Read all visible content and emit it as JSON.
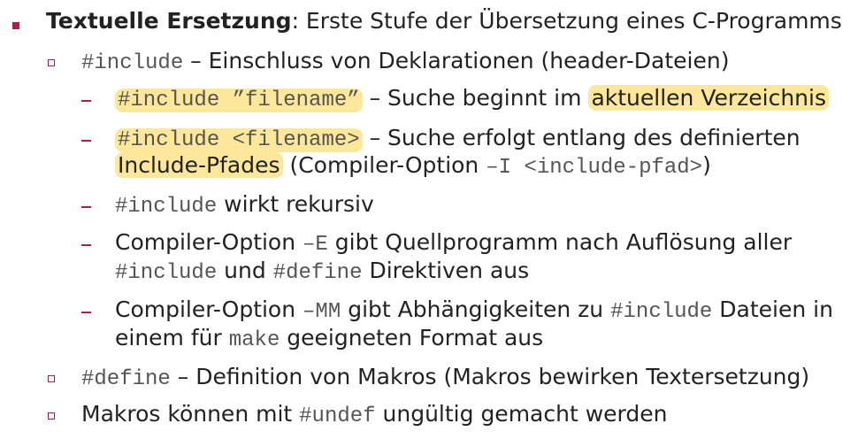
{
  "l1": {
    "head": "Textuelle Ersetzung",
    "rest": ": Erste Stufe der Übersetzung eines C-Programms"
  },
  "l2": {
    "code": "#include",
    "rest": " – Einschluss von Deklarationen (header-Dateien)"
  },
  "l3": {
    "code": "#include ”filename”",
    "mid": " – Suche beginnt im ",
    "hl": "aktuellen Verzeichnis"
  },
  "l4a": {
    "code": "#include <filename>",
    "rest": " – Suche erfolgt entlang des definierten"
  },
  "l4b": {
    "hl": "Include-Pfades",
    "mid": " (Compiler-Option ",
    "code": "–I <include-pfad>",
    "end": ")"
  },
  "l5": {
    "code": "#include",
    "rest": " wirkt rekursiv"
  },
  "l6a": {
    "pre": "Compiler-Option ",
    "code": "–E",
    "rest": " gibt Quellprogramm nach Auflösung aller"
  },
  "l6b": {
    "code1": "#include",
    "mid": " und ",
    "code2": "#define",
    "rest": " Direktiven aus"
  },
  "l7a": {
    "pre": "Compiler-Option ",
    "code1": "–MM",
    "mid": " gibt Abhängigkeiten zu ",
    "code2": "#include",
    "rest": " Dateien in"
  },
  "l7b": {
    "pre": "einem für ",
    "code": "make",
    "rest": " geeigneten Format aus"
  },
  "l8": {
    "code": "#define",
    "rest": " – Definition von Makros (Makros bewirken Textersetzung)"
  },
  "l9": {
    "pre": "Makros können mit ",
    "code": "#undef",
    "rest": " ungültig gemacht werden"
  },
  "colors": {
    "bullet": "#a8204a",
    "highlight": "#fde79a"
  }
}
